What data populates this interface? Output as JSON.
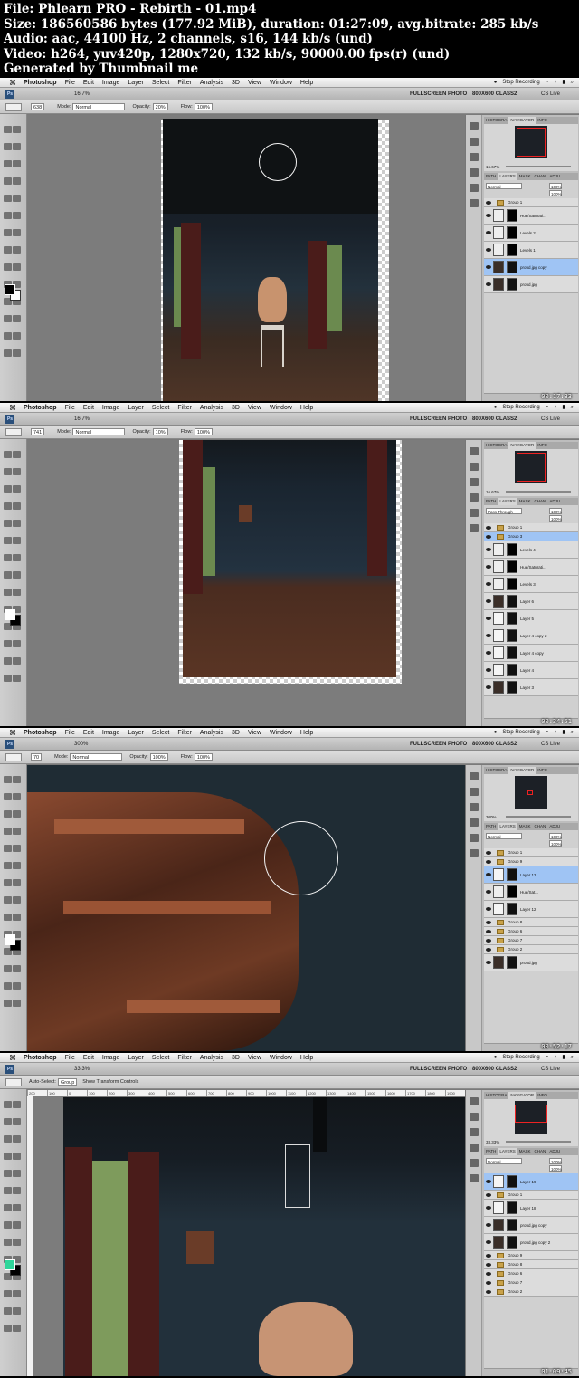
{
  "header": {
    "line1": "File: Phlearn PRO - Rebirth - 01.mp4",
    "line2": "Size: 186560586 bytes (177.92 MiB), duration: 01:27:09, avg.bitrate: 285 kb/s",
    "line3": "Audio: aac, 44100 Hz, 2 channels, s16, 144 kb/s (und)",
    "line4": "Video: h264, yuv420p, 1280x720, 132 kb/s, 90000.00 fps(r) (und)",
    "line5": "Generated by Thumbnail me"
  },
  "menubar": {
    "app": "Photoshop",
    "items": [
      "File",
      "Edit",
      "Image",
      "Layer",
      "Select",
      "Filter",
      "Analysis",
      "3D",
      "View",
      "Window",
      "Help"
    ],
    "stop_recording": "Stop Recording"
  },
  "appbar": {
    "workspace": "FULLSCREEN PHOTO",
    "workspace2": "800X600 CLASS2",
    "cslive": "CS Live"
  },
  "options": {
    "mode_label": "Mode:",
    "mode_value": "Normal",
    "opacity_label": "Opacity:",
    "flow_label": "Flow:",
    "flow_value": "100%",
    "auto_select": "Auto-Select:",
    "auto_select_value": "Group",
    "show_transform": "Show Transform Controls"
  },
  "panel_tabs": {
    "histogram": "HISTOGRA",
    "navigator": "NAVIGATOR",
    "info": "INFO"
  },
  "layer_tabs": {
    "paths": "PATH",
    "layers": "LAYERS",
    "masks": "MASK",
    "channels": "CHAN",
    "adjust": "ADJU"
  },
  "frames": [
    {
      "zoom": "16.7%",
      "brush_size": "638",
      "opacity": "20%",
      "nav_zoom": "16.67%",
      "blend": "Normal",
      "opacity_panel": "100%",
      "fill": "100%",
      "timecode": "00:17:33",
      "layers": [
        {
          "name": "Group 1",
          "type": "group",
          "selected": false
        },
        {
          "name": "Hue/Saturati...",
          "type": "adjust",
          "selected": false
        },
        {
          "name": "Levels 2",
          "type": "adjust",
          "selected": false
        },
        {
          "name": "Levels 1",
          "type": "adjust",
          "selected": false
        },
        {
          "name": "pro5d.jpg copy",
          "type": "photo",
          "selected": true
        },
        {
          "name": "pro5d.jpg",
          "type": "photo",
          "selected": false
        }
      ]
    },
    {
      "zoom": "16.7%",
      "brush_size": "741",
      "opacity": "10%",
      "nav_zoom": "16.67%",
      "blend": "Pass Through",
      "opacity_panel": "100%",
      "fill": "100%",
      "timecode": "00:34:51",
      "layers": [
        {
          "name": "Group 1",
          "type": "group",
          "selected": false
        },
        {
          "name": "Group 3",
          "type": "group",
          "selected": true
        },
        {
          "name": "Levels 4",
          "type": "adjust",
          "selected": false
        },
        {
          "name": "Hue/Saturati...",
          "type": "adjust",
          "selected": false
        },
        {
          "name": "Levels 3",
          "type": "adjust",
          "selected": false
        },
        {
          "name": "Layer 6",
          "type": "photo",
          "selected": false
        },
        {
          "name": "Layer 5",
          "type": "clear",
          "selected": false
        },
        {
          "name": "Layer 4 copy 2",
          "type": "clear",
          "selected": false
        },
        {
          "name": "Layer 4 copy",
          "type": "clear",
          "selected": false
        },
        {
          "name": "Layer 4",
          "type": "clear",
          "selected": false
        },
        {
          "name": "Layer 3",
          "type": "photo",
          "selected": false
        }
      ]
    },
    {
      "zoom": "300%",
      "brush_size": "70",
      "opacity": "100%",
      "nav_zoom": "300%",
      "blend": "Normal",
      "opacity_panel": "100%",
      "fill": "100%",
      "timecode": "00:52:17",
      "layers": [
        {
          "name": "Group 1",
          "type": "group",
          "selected": false
        },
        {
          "name": "Group 9",
          "type": "group",
          "selected": false
        },
        {
          "name": "Layer 13",
          "type": "clear",
          "selected": true
        },
        {
          "name": "Hue/Sat...",
          "type": "adjust",
          "selected": false
        },
        {
          "name": "Layer 12",
          "type": "clear",
          "selected": false
        },
        {
          "name": "Group 8",
          "type": "group",
          "selected": false
        },
        {
          "name": "Group 6",
          "type": "group",
          "selected": false
        },
        {
          "name": "Group 7",
          "type": "group",
          "selected": false
        },
        {
          "name": "Group 2",
          "type": "group",
          "selected": false
        },
        {
          "name": "pro5d.jpg",
          "type": "photo",
          "selected": false
        }
      ]
    },
    {
      "zoom": "33.3%",
      "nav_zoom": "33.33%",
      "blend": "Normal",
      "opacity_panel": "100%",
      "fill": "100%",
      "timecode": "01:09:45",
      "ruler": [
        "200",
        "100",
        "0",
        "100",
        "200",
        "300",
        "400",
        "500",
        "600",
        "700",
        "800",
        "900",
        "1000",
        "1100",
        "1200",
        "1300",
        "1400",
        "1500",
        "1600",
        "1700",
        "1800",
        "1900",
        "2000",
        "2100",
        "2200",
        "2300",
        "2400",
        "2500",
        "2600"
      ],
      "layers": [
        {
          "name": "Layer 19",
          "type": "clear",
          "selected": true
        },
        {
          "name": "Group 1",
          "type": "group",
          "selected": false
        },
        {
          "name": "Layer 18",
          "type": "clear",
          "selected": false
        },
        {
          "name": "pro5d.jpg copy",
          "type": "photo",
          "selected": false
        },
        {
          "name": "pro5d.jpg copy 2",
          "type": "photo",
          "selected": false
        },
        {
          "name": "Group 9",
          "type": "group",
          "selected": false
        },
        {
          "name": "Group 8",
          "type": "group",
          "selected": false
        },
        {
          "name": "Group 6",
          "type": "group",
          "selected": false
        },
        {
          "name": "Group 7",
          "type": "group",
          "selected": false
        },
        {
          "name": "Group 2",
          "type": "group",
          "selected": false
        }
      ]
    }
  ],
  "colors": {
    "foreground_1": "#000000",
    "foreground_4": "#2fd69a",
    "selection": "#9fc4f4",
    "nav_box": "#e22222"
  }
}
